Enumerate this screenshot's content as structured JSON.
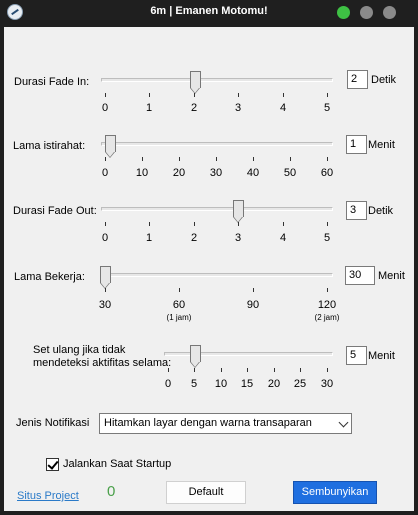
{
  "window": {
    "title": "6m | Emanen Motomu!",
    "controls": {
      "maximize_color": "#3ec144",
      "minimize_color": "#8a8a8a",
      "close_color": "#8a8a8a"
    }
  },
  "fade_in": {
    "label": "Durasi Fade In:",
    "value": "2",
    "unit": "Detik",
    "ticks": [
      "0",
      "1",
      "2",
      "3",
      "4",
      "5"
    ]
  },
  "rest": {
    "label": "Lama istirahat:",
    "value": "1",
    "unit": "Menit",
    "ticks": [
      "0",
      "10",
      "20",
      "30",
      "40",
      "50",
      "60"
    ]
  },
  "fade_out": {
    "label": "Durasi Fade Out:",
    "value": "3",
    "unit": "Detik",
    "ticks": [
      "0",
      "1",
      "2",
      "3",
      "4",
      "5"
    ]
  },
  "work": {
    "label": "Lama Bekerja:",
    "value": "30",
    "unit": "Menit",
    "ticks": [
      "30",
      "60",
      "90",
      "120"
    ],
    "sub_labels": [
      "(1 jam)",
      "(2 jam)"
    ]
  },
  "reset": {
    "label_line1": "Set ulang jika tidak",
    "label_line2": "mendeteksi aktifitas selama:",
    "value": "5",
    "unit": "Menit",
    "ticks": [
      "0",
      "5",
      "10",
      "15",
      "20",
      "25",
      "30"
    ]
  },
  "notification": {
    "label": "Jenis Notifikasi",
    "selected": "Hitamkan layar dengan warna transaparan"
  },
  "startup": {
    "label": "Jalankan Saat Startup",
    "checked": true
  },
  "footer": {
    "link": "Situs Project",
    "counter": "0",
    "default_button": "Default",
    "hide_button": "Sembunyikan"
  },
  "colors": {
    "accent": "#1f6fe0",
    "link": "#2a7ac8",
    "counter": "#4aa04a"
  }
}
